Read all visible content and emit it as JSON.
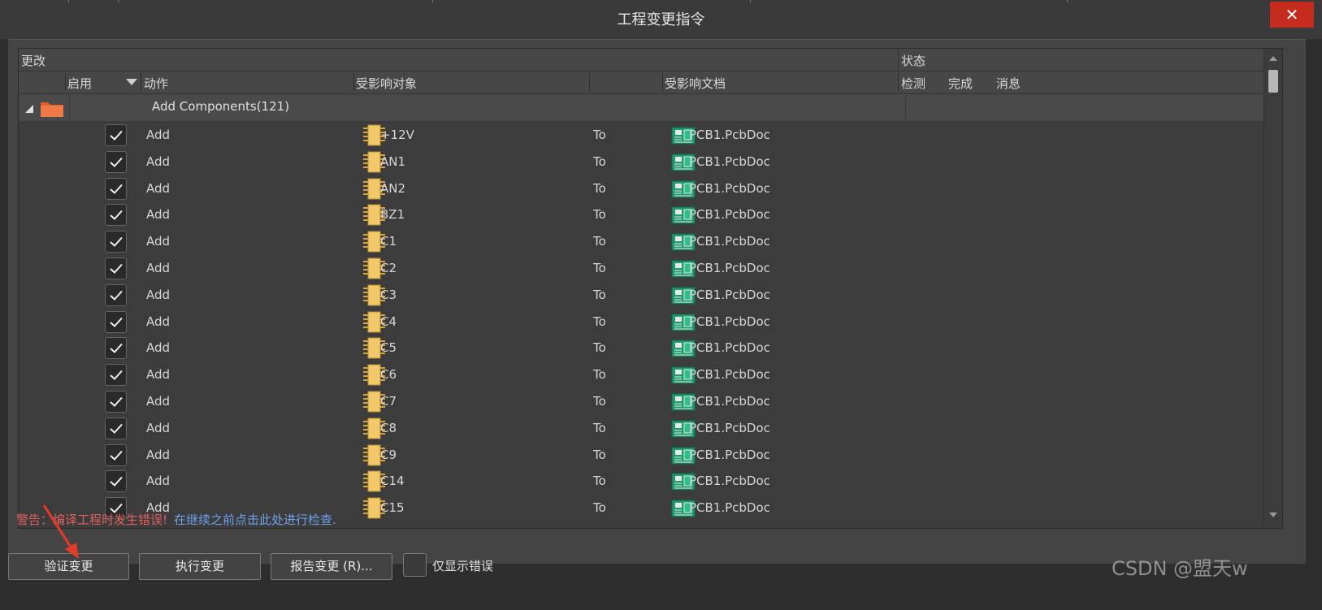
{
  "window": {
    "title": "工程变更指令",
    "close_symbol": "✕"
  },
  "header": {
    "changes": "更改",
    "status": "状态",
    "enable": "启用",
    "action": "动作",
    "affected_object": "受影响对象",
    "affected_document": "受影响文档",
    "check": "检测",
    "done": "完成",
    "message": "消息"
  },
  "group": {
    "label": "Add Components(121)",
    "folder_icon": "folder-icon",
    "folder_color": "#e2612f"
  },
  "rows": [
    {
      "action": "Add",
      "object": "+12V",
      "to": "To",
      "document": "PCB1.PcbDoc"
    },
    {
      "action": "Add",
      "object": "AN1",
      "to": "To",
      "document": "PCB1.PcbDoc"
    },
    {
      "action": "Add",
      "object": "AN2",
      "to": "To",
      "document": "PCB1.PcbDoc"
    },
    {
      "action": "Add",
      "object": "BZ1",
      "to": "To",
      "document": "PCB1.PcbDoc"
    },
    {
      "action": "Add",
      "object": "C1",
      "to": "To",
      "document": "PCB1.PcbDoc"
    },
    {
      "action": "Add",
      "object": "C2",
      "to": "To",
      "document": "PCB1.PcbDoc"
    },
    {
      "action": "Add",
      "object": "C3",
      "to": "To",
      "document": "PCB1.PcbDoc"
    },
    {
      "action": "Add",
      "object": "C4",
      "to": "To",
      "document": "PCB1.PcbDoc"
    },
    {
      "action": "Add",
      "object": "C5",
      "to": "To",
      "document": "PCB1.PcbDoc"
    },
    {
      "action": "Add",
      "object": "C6",
      "to": "To",
      "document": "PCB1.PcbDoc"
    },
    {
      "action": "Add",
      "object": "C7",
      "to": "To",
      "document": "PCB1.PcbDoc"
    },
    {
      "action": "Add",
      "object": "C8",
      "to": "To",
      "document": "PCB1.PcbDoc"
    },
    {
      "action": "Add",
      "object": "C9",
      "to": "To",
      "document": "PCB1.PcbDoc"
    },
    {
      "action": "Add",
      "object": "C14",
      "to": "To",
      "document": "PCB1.PcbDoc"
    },
    {
      "action": "Add",
      "object": "C15",
      "to": "To",
      "document": "PCB1.PcbDoc"
    }
  ],
  "status_line": {
    "warning": "警告：编译工程时发生错误!",
    "link": "在继续之前点击此处进行检查."
  },
  "buttons": {
    "validate": "验证变更",
    "execute": "执行变更",
    "report": "报告变更 (R)..."
  },
  "only_errors_label": "仅显示错误",
  "watermark": "CSDN @盟天w",
  "colors": {
    "warning": "#e06060",
    "link": "#6fa0e8",
    "close": "#c42b1c"
  }
}
